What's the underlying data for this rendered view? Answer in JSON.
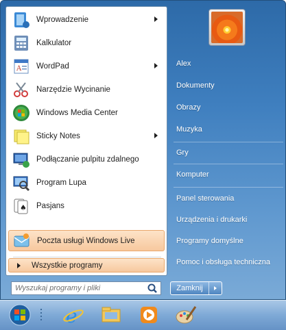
{
  "programs": [
    {
      "label": "Wprowadzenie",
      "icon": "getting-started-icon",
      "submenu": true
    },
    {
      "label": "Kalkulator",
      "icon": "calculator-icon",
      "submenu": false
    },
    {
      "label": "WordPad",
      "icon": "wordpad-icon",
      "submenu": true
    },
    {
      "label": "Narzędzie Wycinanie",
      "icon": "snipping-tool-icon",
      "submenu": false
    },
    {
      "label": "Windows Media Center",
      "icon": "media-center-icon",
      "submenu": false
    },
    {
      "label": "Sticky Notes",
      "icon": "sticky-notes-icon",
      "submenu": true
    },
    {
      "label": "Podłączanie pulpitu zdalnego",
      "icon": "remote-desktop-icon",
      "submenu": false
    },
    {
      "label": "Program Lupa",
      "icon": "magnifier-icon",
      "submenu": false
    },
    {
      "label": "Pasjans",
      "icon": "solitaire-icon",
      "submenu": false
    },
    {
      "label": "Poczta usługi Windows Live",
      "icon": "windows-live-mail-icon",
      "submenu": false
    }
  ],
  "all_programs": "Wszystkie programy",
  "search": {
    "placeholder": "Wyszukaj programy i pliki"
  },
  "right_items": [
    "Alex",
    "Dokumenty",
    "Obrazy",
    "Muzyka",
    "Gry",
    "Komputer",
    "Panel sterowania",
    "Urządzenia i drukarki",
    "Programy domyślne",
    "Pomoc i obsługa techniczna"
  ],
  "shutdown": {
    "label": "Zamknij"
  },
  "taskbar": [
    "start-orb-icon",
    "internet-explorer-icon",
    "windows-explorer-icon",
    "media-player-icon",
    "paint-icon"
  ],
  "colors": {
    "accent": "#3f7fbf",
    "highlight": "#f7c89e"
  }
}
